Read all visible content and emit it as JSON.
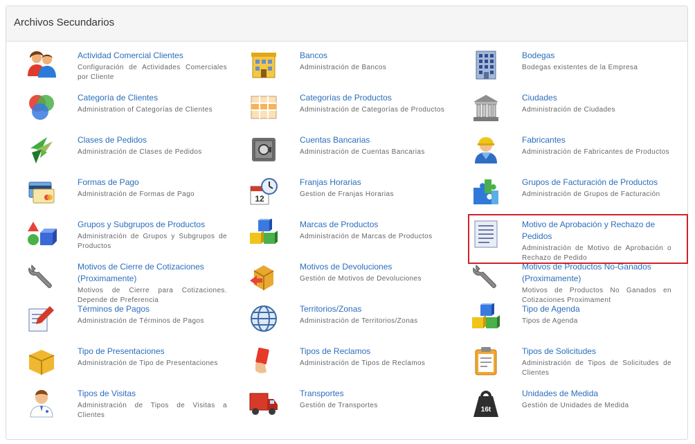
{
  "panel": {
    "title": "Archivos Secundarios"
  },
  "items": [
    {
      "title": "Actividad Comercial Clientes",
      "desc": "Configuración de Actividades Comerciales por Cliente",
      "icon": "users-icon"
    },
    {
      "title": "Bancos",
      "desc": "Administración de Bancos",
      "icon": "bank-building-icon"
    },
    {
      "title": "Bodegas",
      "desc": "Bodegas existentes de la Empresa",
      "icon": "warehouse-building-icon"
    },
    {
      "title": "Categoría de Clientes",
      "desc": "Administration of Categorías de Clientes",
      "icon": "circles-icon"
    },
    {
      "title": "Categorías de Productos",
      "desc": "Administración de Categorías de Productos",
      "icon": "grid-table-icon"
    },
    {
      "title": "Ciudades",
      "desc": "Administración de Ciudades",
      "icon": "city-hall-icon"
    },
    {
      "title": "Clases de Pedidos",
      "desc": "Administración de Clases de Pedidos",
      "icon": "origami-bird-icon"
    },
    {
      "title": "Cuentas Bancarias",
      "desc": "Administración de Cuentas Bancarias",
      "icon": "safe-icon"
    },
    {
      "title": "Fabricantes",
      "desc": "Administración de Fabricantes de Productos",
      "icon": "worker-icon"
    },
    {
      "title": "Formas de Pago",
      "desc": "Administración de Formas de Pago",
      "icon": "credit-cards-icon"
    },
    {
      "title": "Franjas Horarias",
      "desc": "Gestion de Franjas Horarias",
      "icon": "calendar-clock-icon"
    },
    {
      "title": "Grupos de Facturación de Productos",
      "desc": "Administración de Grupos de Facturación",
      "icon": "puzzle-icon"
    },
    {
      "title": "Grupos y Subgrupos de Productos",
      "desc": "Administración de Grupos y Subgrupos de Productos",
      "icon": "shapes-icon"
    },
    {
      "title": "Marcas de Productos",
      "desc": "Administración de Marcas de Productos",
      "icon": "blocks-icon"
    },
    {
      "title": "Motivo de Aprobación y Rechazo de Pedidos",
      "desc": "Administración de Motivo de Aprobación o Rechazo de Pedido",
      "icon": "document-list-icon"
    },
    {
      "title": "Motivos de Cierre de Cotizaciones (Proximamente)",
      "desc": "Motivos de Cierre para Cotizaciones. Depende de Preferencia",
      "icon": "wrench-icon"
    },
    {
      "title": "Motivos de Devoluciones",
      "desc": "Gestión de Motivos de Devoluciones",
      "icon": "box-return-icon"
    },
    {
      "title": "Motivos de Productos No-Ganados (Proximamente)",
      "desc": "Motivos de Productos No Ganados en Cotizaciones Proximament",
      "icon": "wrench-icon"
    },
    {
      "title": "Términos de Pagos",
      "desc": "Administración de Términos de Pagos",
      "icon": "pen-paper-icon"
    },
    {
      "title": "Territorios/Zonas",
      "desc": "Administración de Territorios/Zonas",
      "icon": "globe-icon"
    },
    {
      "title": "Tipo de Agenda",
      "desc": "Tipos de Agenda",
      "icon": "blocks-icon"
    },
    {
      "title": "Tipo de Presentaciones",
      "desc": "Administración de Tipo de Presentaciones",
      "icon": "package-icon"
    },
    {
      "title": "Tipos de Reclamos",
      "desc": "Administración de Tipos de Reclamos",
      "icon": "red-card-icon"
    },
    {
      "title": "Tipos de Solicitudes",
      "desc": "Administración de Tipos de Solicitudes de Clientes",
      "icon": "clipboard-icon"
    },
    {
      "title": "Tipos de Visitas",
      "desc": "Administración de Tipos de Visitas a Clientes",
      "icon": "doctor-icon"
    },
    {
      "title": "Transportes",
      "desc": "Gestión de Transportes",
      "icon": "truck-icon"
    },
    {
      "title": "Unidades de Medida",
      "desc": "Gestión de Unidades de Medida",
      "icon": "weight-icon"
    }
  ],
  "highlight_color": "#d0202a",
  "link_color": "#2a6ebb"
}
